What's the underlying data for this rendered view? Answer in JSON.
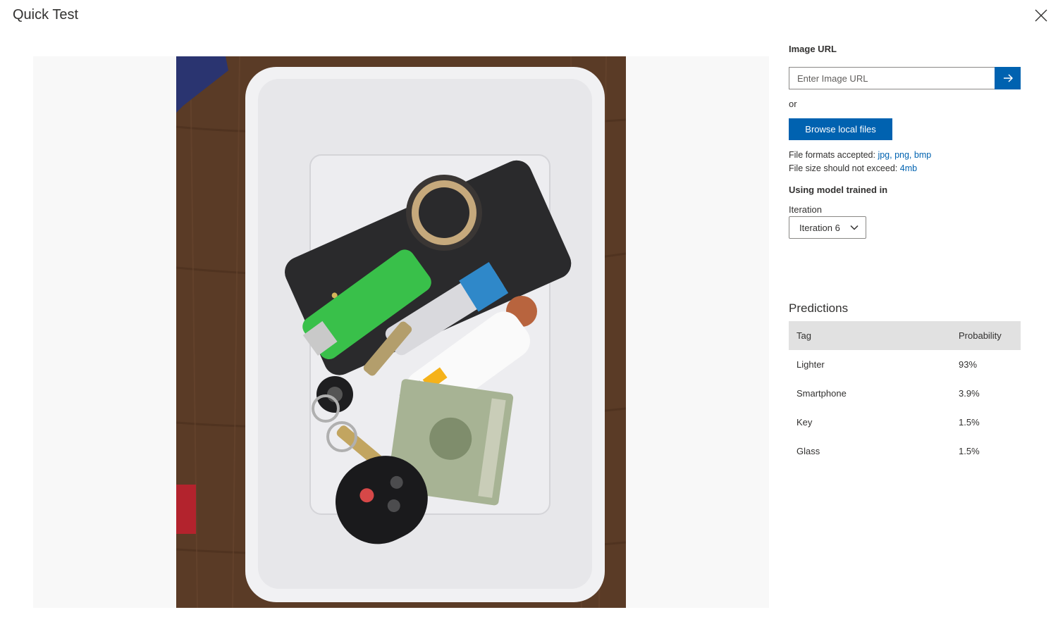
{
  "dialog": {
    "title": "Quick Test",
    "close_icon": "close-icon"
  },
  "preview": {
    "image_alt": "Tray with smartphone, lighters, keys, coins and dollar bills"
  },
  "image_url": {
    "label": "Image URL",
    "placeholder": "Enter Image URL",
    "value": "",
    "submit_icon": "arrow-right-icon"
  },
  "or_text": "or",
  "browse_button": "Browse local files",
  "file_formats": {
    "label": "File formats accepted:",
    "values": "jpg, png, bmp"
  },
  "file_size": {
    "label": "File size should not exceed:",
    "value": "4mb"
  },
  "model": {
    "label": "Using model trained in",
    "iteration_label": "Iteration",
    "iteration_selected": "Iteration 6",
    "dropdown_icon": "chevron-down-icon"
  },
  "predictions": {
    "title": "Predictions",
    "columns": [
      "Tag",
      "Probability"
    ],
    "rows": [
      {
        "tag": "Lighter",
        "probability": "93%"
      },
      {
        "tag": "Smartphone",
        "probability": "3.9%"
      },
      {
        "tag": "Key",
        "probability": "1.5%"
      },
      {
        "tag": "Glass",
        "probability": "1.5%"
      }
    ]
  },
  "colors": {
    "accent": "#0062b0",
    "header_bg": "#e1e1e1",
    "preview_bg": "#f8f8f8"
  }
}
